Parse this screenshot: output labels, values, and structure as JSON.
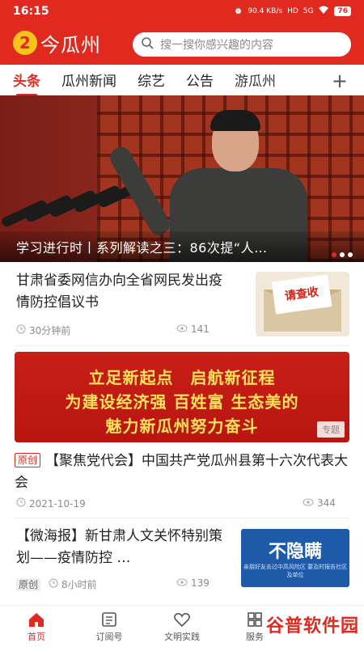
{
  "status": {
    "time": "16:15",
    "net_speed": "90.4 KB/s",
    "hd": "HD",
    "signal": "5G",
    "battery": "76"
  },
  "brand": {
    "logo_char": "2",
    "name": "今瓜州"
  },
  "search": {
    "placeholder": "搜一搜你感兴趣的内容"
  },
  "tabs": [
    {
      "label": "头条"
    },
    {
      "label": "瓜州新闻"
    },
    {
      "label": "综艺"
    },
    {
      "label": "公告"
    },
    {
      "label": "游瓜州"
    }
  ],
  "tab_more": "+",
  "hero": {
    "caption": "学习进行时丨系列解读之三：86次提“人…"
  },
  "articles": [
    {
      "title": "甘肃省委网信办向全省网民发出疫情防控倡议书",
      "time": "30分钟前",
      "views": "141",
      "thumb_text": "请查收"
    },
    {
      "badge": "原创",
      "title": "【聚焦党代会】中国共产党瓜州县第十六次代表大会",
      "time": "2021-10-19",
      "views": "344"
    },
    {
      "badge": "原创",
      "title": "【微海报】新甘肃人文关怀特别策划——疫情防控 …",
      "time": "8小时前",
      "views": "139",
      "thumb_big": "不隐瞒",
      "thumb_small": "亲朋好友去过中高风险区 要及时报告社区及单位"
    }
  ],
  "banner": {
    "line1": "立足新起点　启航新征程",
    "line2": "为建设经济强 百姓富 生态美的",
    "line3": "魅力新瓜州努力奋斗",
    "tag": "专题"
  },
  "bottom_nav": [
    {
      "label": "首页"
    },
    {
      "label": "订阅号"
    },
    {
      "label": "文明实践"
    },
    {
      "label": "服务"
    }
  ],
  "watermark": "谷普软件园"
}
